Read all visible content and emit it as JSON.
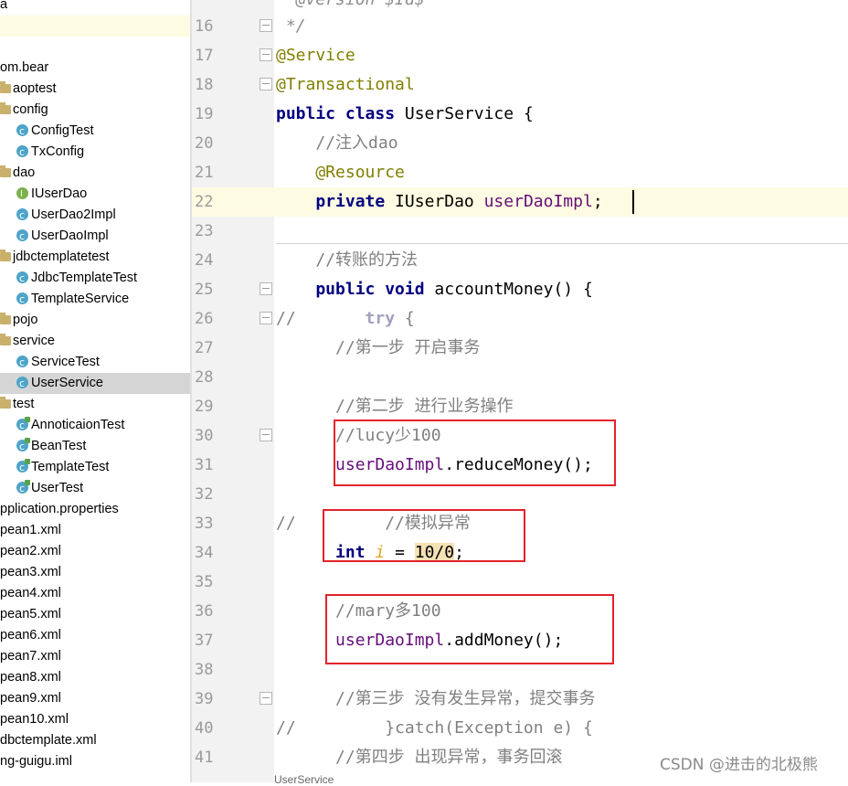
{
  "project_tree": [
    {
      "label": "a",
      "type": "text"
    },
    {
      "label": "",
      "type": "blank"
    },
    {
      "label": "",
      "type": "blank"
    },
    {
      "label": "om.bear",
      "type": "text"
    },
    {
      "label": "aoptest",
      "type": "folder"
    },
    {
      "label": "config",
      "type": "folder"
    },
    {
      "label": "ConfigTest",
      "type": "class"
    },
    {
      "label": "TxConfig",
      "type": "class"
    },
    {
      "label": "dao",
      "type": "folder"
    },
    {
      "label": "IUserDao",
      "type": "interface"
    },
    {
      "label": "UserDao2Impl",
      "type": "class"
    },
    {
      "label": "UserDaoImpl",
      "type": "class"
    },
    {
      "label": "jdbctemplatetest",
      "type": "folder"
    },
    {
      "label": "JdbcTemplateTest",
      "type": "class"
    },
    {
      "label": "TemplateService",
      "type": "class"
    },
    {
      "label": "pojo",
      "type": "folder"
    },
    {
      "label": "service",
      "type": "folder"
    },
    {
      "label": "ServiceTest",
      "type": "class"
    },
    {
      "label": "UserService",
      "type": "class",
      "selected": true
    },
    {
      "label": "test",
      "type": "folder"
    },
    {
      "label": "AnnoticaionTest",
      "type": "test"
    },
    {
      "label": "BeanTest",
      "type": "test"
    },
    {
      "label": "TemplateTest",
      "type": "test"
    },
    {
      "label": "UserTest",
      "type": "test"
    },
    {
      "label": "pplication.properties",
      "type": "text"
    },
    {
      "label": "pean1.xml",
      "type": "text"
    },
    {
      "label": "pean2.xml",
      "type": "text"
    },
    {
      "label": "pean3.xml",
      "type": "text"
    },
    {
      "label": "pean4.xml",
      "type": "text"
    },
    {
      "label": "pean5.xml",
      "type": "text"
    },
    {
      "label": "pean6.xml",
      "type": "text"
    },
    {
      "label": "pean7.xml",
      "type": "text"
    },
    {
      "label": "pean8.xml",
      "type": "text"
    },
    {
      "label": "pean9.xml",
      "type": "text"
    },
    {
      "label": "pean10.xml",
      "type": "text"
    },
    {
      "label": "dbctemplate.xml",
      "type": "text"
    },
    {
      "label": "ng-guigu.iml",
      "type": "text"
    }
  ],
  "line_numbers": [
    "16",
    "17",
    "18",
    "19",
    "20",
    "21",
    "22",
    "23",
    "24",
    "25",
    "26",
    "27",
    "28",
    "29",
    "30",
    "31",
    "32",
    "33",
    "34",
    "35",
    "36",
    "37",
    "38",
    "39",
    "40",
    "41"
  ],
  "code_lines": {
    "l15": "* @version $Id$",
    "l16": " */",
    "l17": "@Service",
    "l18": "@Transactional",
    "l19_kw": "public class",
    "l19_rest": " UserService {",
    "l20": "    //注入dao",
    "l21": "    @Resource",
    "l22_kw": "    private",
    "l22_type": " IUserDao ",
    "l22_field": "userDaoImpl",
    "l22_end": ";",
    "l24": "    //转账的方法",
    "l25_kw": "    public void",
    "l25_rest": " accountMoney() {",
    "l26_prefix": "//",
    "l26_kw": "       try",
    "l26_rest": " {",
    "l27": "      //第一步 开启事务",
    "l29": "      //第二步 进行业务操作",
    "l30": "      //lucy少100",
    "l31_field": "      userDaoImpl",
    "l31_rest": ".reduceMoney();",
    "l33_prefix": "//",
    "l33": "         //模拟异常",
    "l34_kw": "      int",
    "l34_var": "i",
    "l34_eq": " = ",
    "l34_num": "10/0",
    "l34_end": ";",
    "l36": "      //mary多100",
    "l37_field": "      userDaoImpl",
    "l37_rest": ".addMoney();",
    "l39": "      //第三步 没有发生异常，提交事务",
    "l40_prefix": "//",
    "l40": "         }catch(Exception e) {",
    "l41": "      //第四步 出现异常，事务回滚"
  },
  "status_tab": "UserService",
  "watermark": "CSDN @进击的北极熊"
}
